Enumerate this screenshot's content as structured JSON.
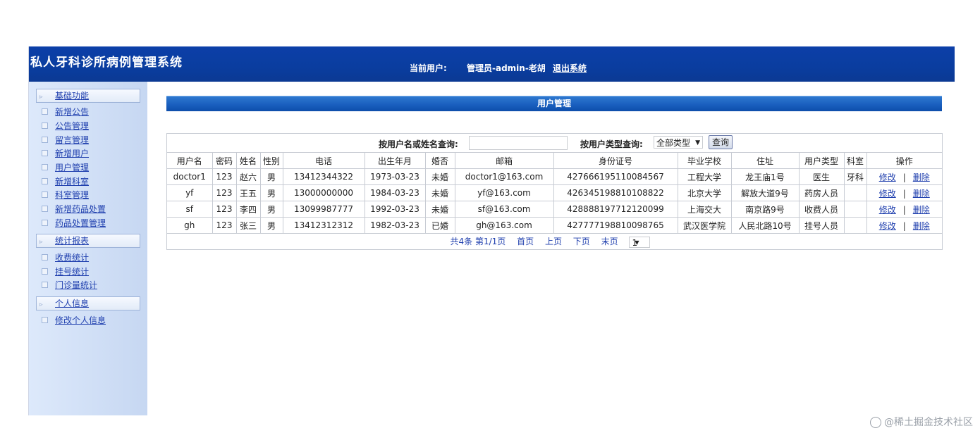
{
  "app": {
    "title": "私人牙科诊所病例管理系统",
    "current_user_label": "当前用户:",
    "current_user": "管理员-admin-老胡",
    "logout": "退出系统"
  },
  "sidebar": {
    "sections": [
      {
        "label": "基础功能",
        "items": [
          "新增公告",
          "公告管理",
          "留言管理",
          "新增用户",
          "用户管理",
          "新增科室",
          "科室管理",
          "新增药品处置",
          "药品处置管理"
        ]
      },
      {
        "label": "统计报表",
        "items": [
          "收费统计",
          "挂号统计",
          "门诊量统计"
        ]
      },
      {
        "label": "个人信息",
        "items": [
          "修改个人信息"
        ]
      }
    ]
  },
  "panel": {
    "title": "用户管理"
  },
  "search": {
    "name_label": "按用户名或姓名查询:",
    "name_value": "",
    "type_label": "按用户类型查询:",
    "type_value": "全部类型",
    "button": "查询"
  },
  "table": {
    "columns": [
      "用户名",
      "密码",
      "姓名",
      "性别",
      "电话",
      "出生年月",
      "婚否",
      "邮箱",
      "身份证号",
      "毕业学校",
      "住址",
      "用户类型",
      "科室",
      "操作"
    ],
    "rows": [
      [
        "doctor1",
        "123",
        "赵六",
        "男",
        "13412344322",
        "1973-03-23",
        "未婚",
        "doctor1@163.com",
        "427666195110084567",
        "工程大学",
        "龙王庙1号",
        "医生",
        "牙科"
      ],
      [
        "yf",
        "123",
        "王五",
        "男",
        "13000000000",
        "1984-03-23",
        "未婚",
        "yf@163.com",
        "426345198810108822",
        "北京大学",
        "解放大道9号",
        "药房人员",
        ""
      ],
      [
        "sf",
        "123",
        "李四",
        "男",
        "13099987777",
        "1992-03-23",
        "未婚",
        "sf@163.com",
        "428888197712120099",
        "上海交大",
        "南京路9号",
        "收费人员",
        ""
      ],
      [
        "gh",
        "123",
        "张三",
        "男",
        "13412312312",
        "1982-03-23",
        "已婚",
        "gh@163.com",
        "427777198810098765",
        "武汉医学院",
        "人民北路10号",
        "挂号人员",
        ""
      ]
    ],
    "edit_label": "修改",
    "delete_label": "删除",
    "separator": "|"
  },
  "pager": {
    "summary": "共4条 第1/1页",
    "first": "首页",
    "prev": "上页",
    "next": "下页",
    "last": "末页",
    "page": "1"
  },
  "watermark": "@稀土掘金技术社区",
  "colors": {
    "header": "#0a3d9f",
    "panel_title": "#1a5fbf",
    "link": "#1f3fae",
    "sidebar": "#d3e1f6"
  }
}
